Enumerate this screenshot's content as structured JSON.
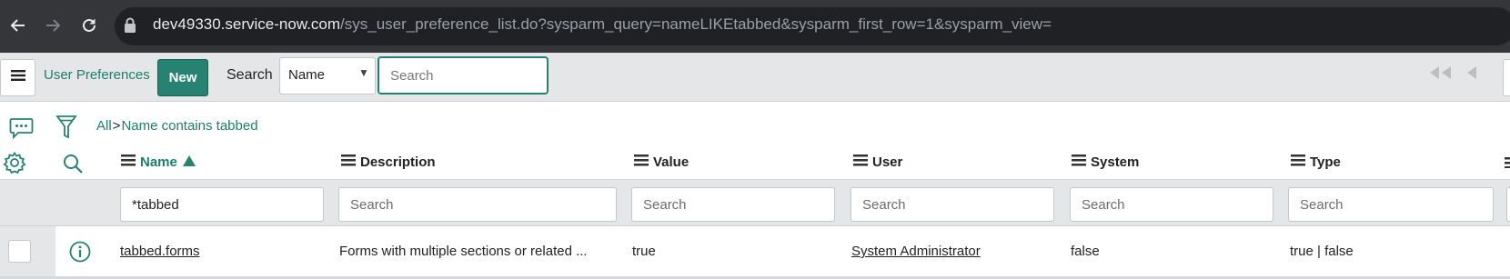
{
  "browser": {
    "url_host": "dev49330.service-now.com",
    "url_path": "/sys_user_preference_list.do?sysparm_query=nameLIKEtabbed&sysparm_first_row=1&sysparm_view="
  },
  "header": {
    "title": "User Preferences",
    "new_label": "New",
    "search_label": "Search",
    "search_field_selected": "Name",
    "search_placeholder": "Search"
  },
  "breadcrumb": {
    "all": "All",
    "separator": ">",
    "condition": "Name contains tabbed"
  },
  "columns": [
    {
      "label": "Name",
      "sort": "ascending"
    },
    {
      "label": "Description"
    },
    {
      "label": "Value"
    },
    {
      "label": "User"
    },
    {
      "label": "System"
    },
    {
      "label": "Type"
    }
  ],
  "filters": {
    "name": "*tabbed",
    "placeholder": "Search"
  },
  "rows": [
    {
      "name": "tabbed.forms",
      "description": "Forms with multiple sections or related ...",
      "value": "true",
      "user": "System Administrator",
      "system": "false",
      "type": "true | false"
    }
  ],
  "colors": {
    "accent": "#278272",
    "link_text": "#1f7d6d",
    "header_bg": "#e4e6e7",
    "browser_bg": "#35363a"
  },
  "icons": [
    "back-arrow-icon",
    "forward-arrow-icon",
    "reload-icon",
    "lock-icon",
    "hamburger-menu-icon",
    "first-page-icon",
    "previous-page-icon",
    "chat-icon",
    "filter-funnel-icon",
    "gear-icon",
    "search-icon",
    "sort-ascending-icon",
    "column-menu-icon",
    "info-circle-icon"
  ]
}
